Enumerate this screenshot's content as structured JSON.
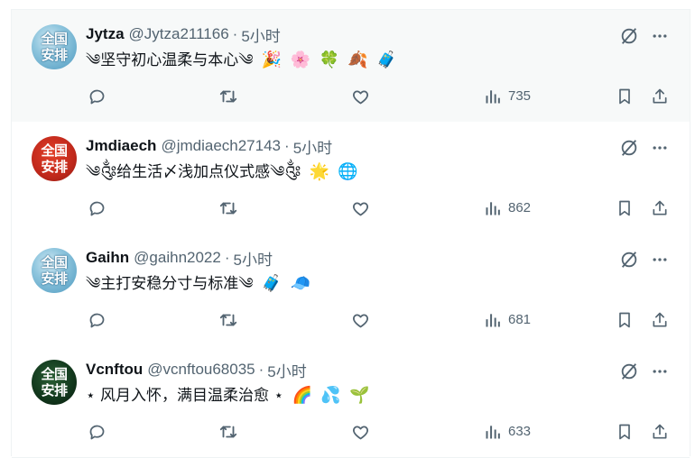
{
  "tweets": [
    {
      "name": "Jytza",
      "handle": "@Jytza211166",
      "separator": "·",
      "time": "5小时",
      "avatar": {
        "line1": "全国",
        "line2": "安排",
        "style": "blue"
      },
      "text": "༄坚守初心温柔与本心༄",
      "emojis": [
        "🎉",
        "🌸",
        "🍀",
        "🍂",
        "🧳"
      ],
      "views": "735",
      "hovered": true
    },
    {
      "name": "Jmdiaech",
      "handle": "@jmdiaech27143",
      "separator": "·",
      "time": "5小时",
      "avatar": {
        "line1": "全国",
        "line2": "安排",
        "style": "red"
      },
      "text": "༄༂给生活〆浅加点仪式感༄༂",
      "emojis": [
        "🌟",
        "🌐"
      ],
      "views": "862",
      "hovered": false
    },
    {
      "name": "Gaihn",
      "handle": "@gaihn2022",
      "separator": "·",
      "time": "5小时",
      "avatar": {
        "line1": "全国",
        "line2": "安排",
        "style": "blue"
      },
      "text": "༄主打安稳分寸与标准༄",
      "emojis": [
        "🧳",
        "🧢"
      ],
      "views": "681",
      "hovered": false
    },
    {
      "name": "Vcnftou",
      "handle": "@vcnftou68035",
      "separator": "·",
      "time": "5小时",
      "avatar": {
        "line1": "全国",
        "line2": "安排",
        "style": "green"
      },
      "text": "⋆ 风月入怀，满目温柔治愈 ⋆",
      "emojis": [
        "🌈",
        "💦",
        "🌱"
      ],
      "views": "633",
      "hovered": false
    }
  ],
  "icons": {
    "grok": "grok-icon",
    "more": "more-icon",
    "reply": "reply-icon",
    "retweet": "retweet-icon",
    "like": "like-icon",
    "views": "views-icon",
    "bookmark": "bookmark-icon",
    "share": "share-icon"
  },
  "colors": {
    "icon": "#536471",
    "text": "#0f1419",
    "hover_bg": "#f7f9f9",
    "divider": "#eff3f4"
  }
}
